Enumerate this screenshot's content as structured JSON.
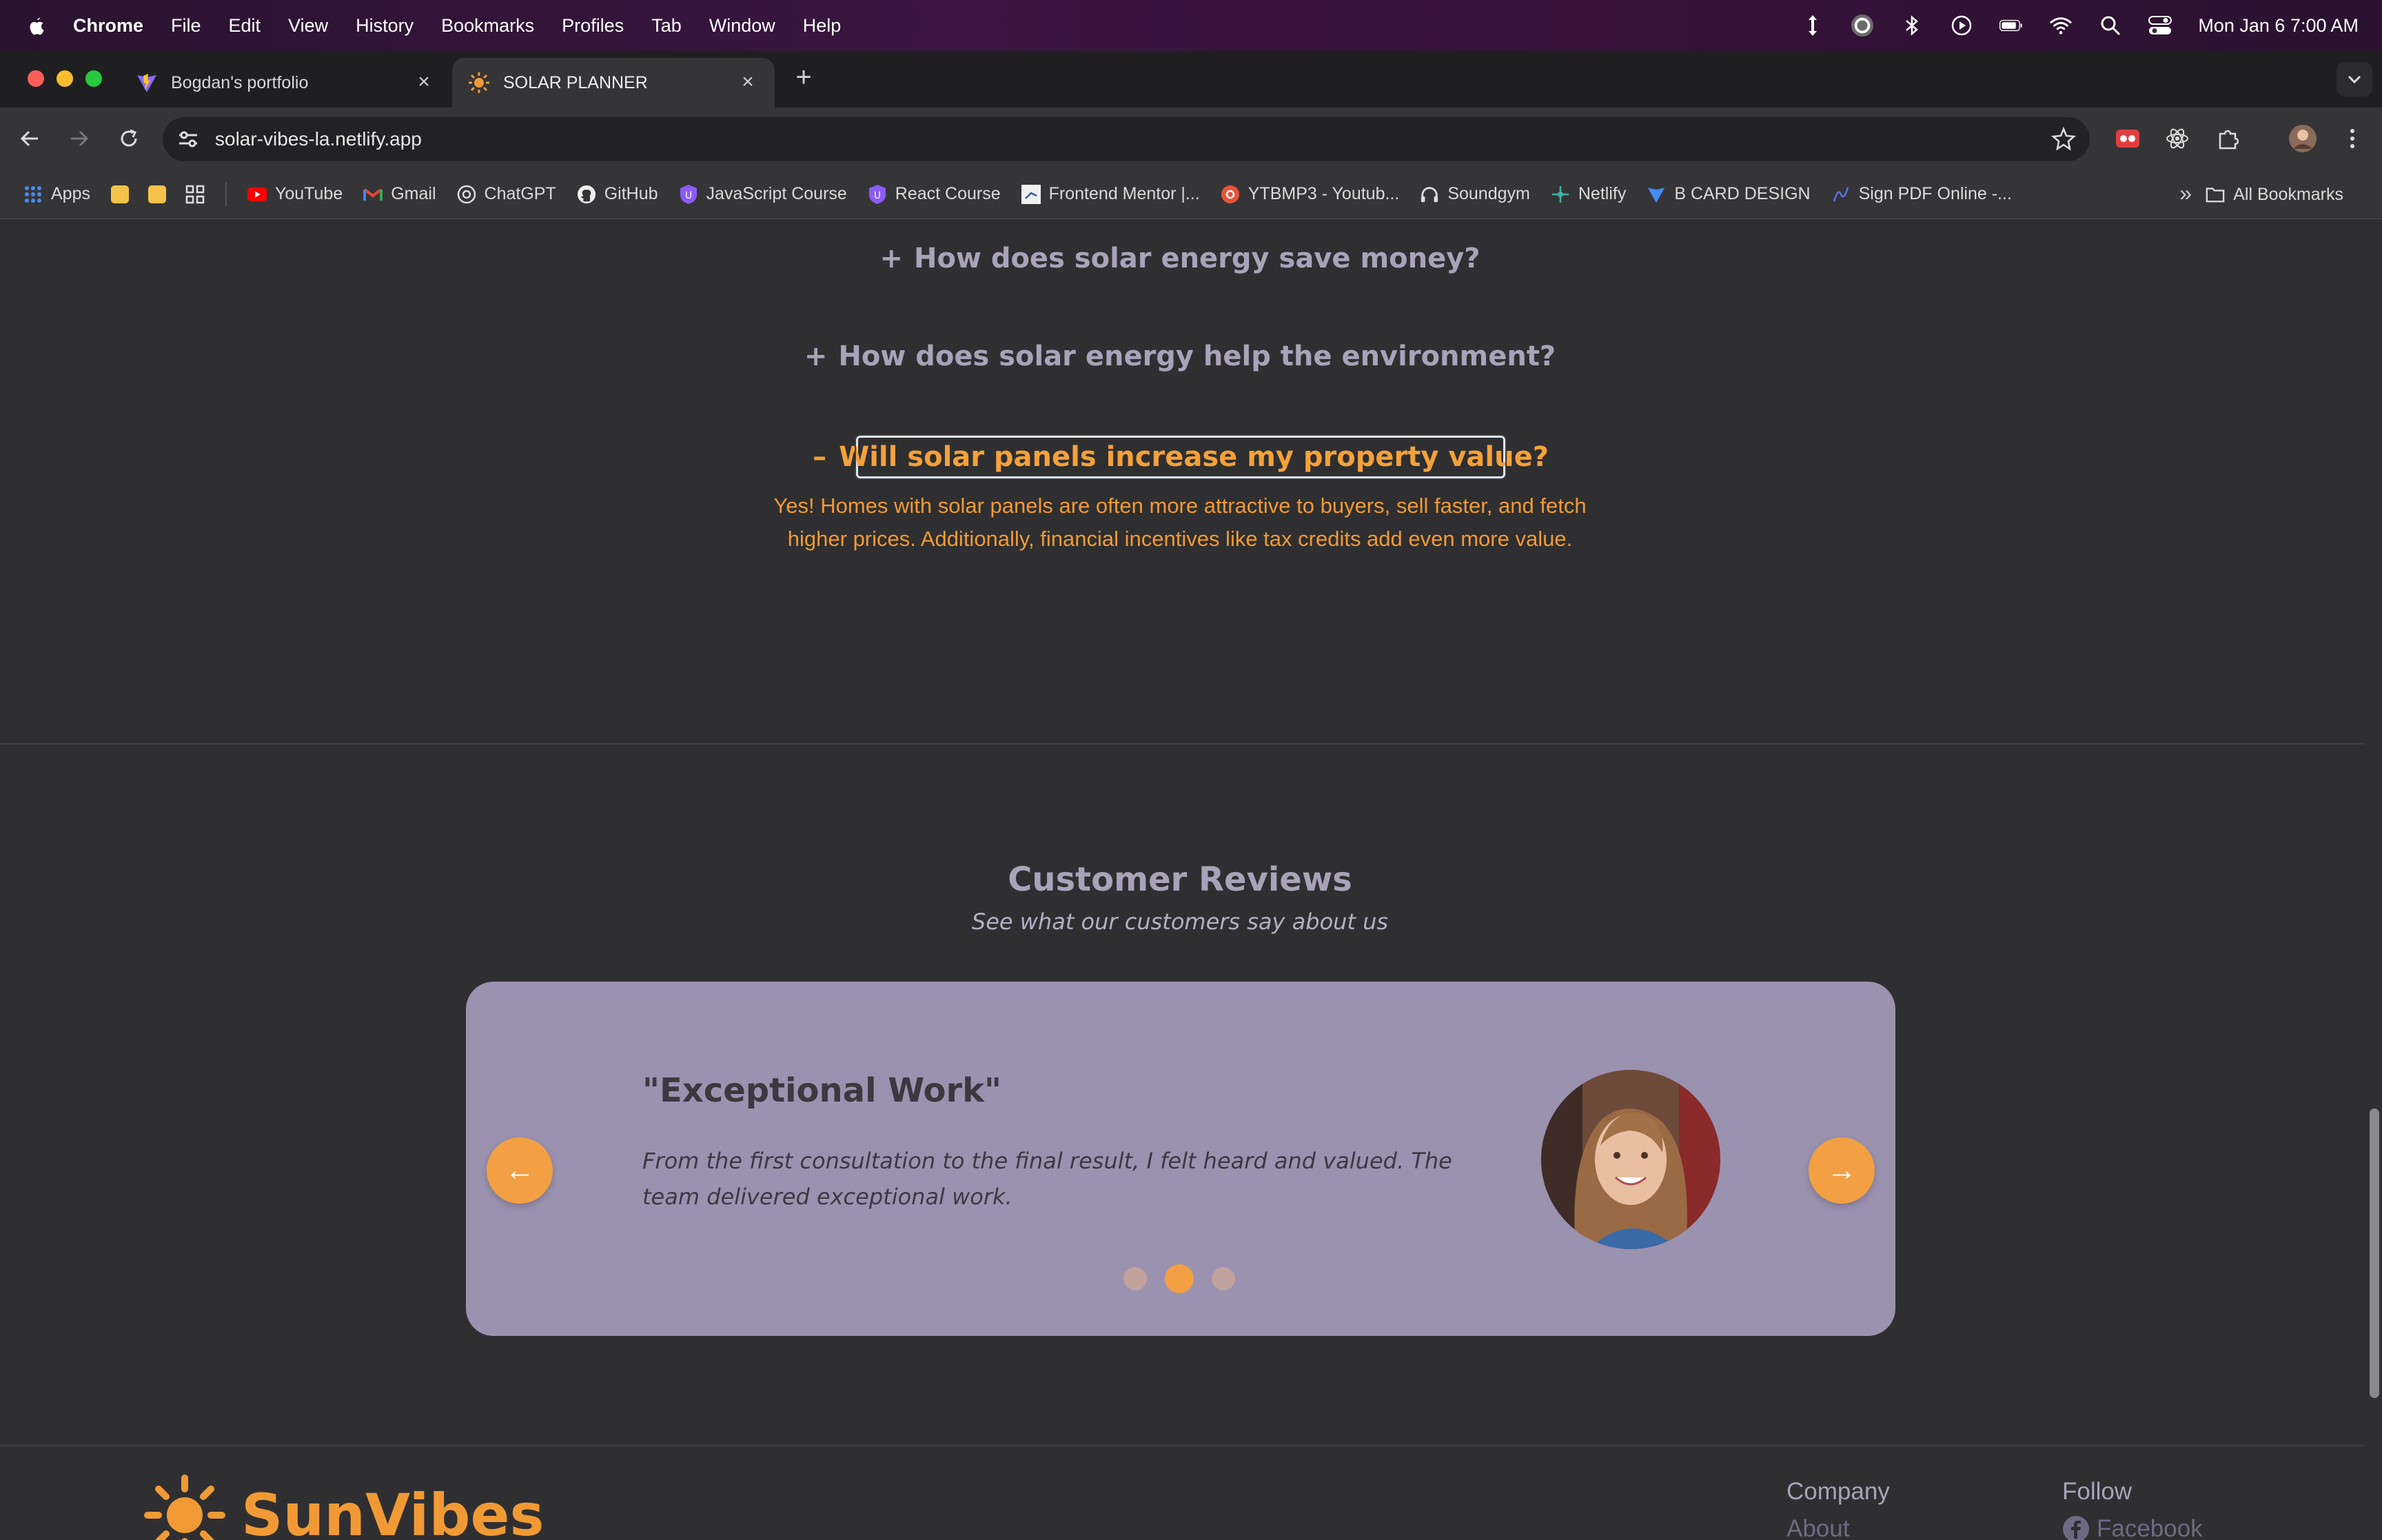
{
  "menubar": {
    "app": "Chrome",
    "items": [
      "File",
      "Edit",
      "View",
      "History",
      "Bookmarks",
      "Profiles",
      "Tab",
      "Window",
      "Help"
    ],
    "clock": "Mon Jan 6  7:00 AM"
  },
  "tabs": [
    {
      "title": "Bogdan's portfolio",
      "icon": "vite-icon"
    },
    {
      "title": "SOLAR PLANNER",
      "icon": "sun-icon"
    }
  ],
  "toolbar": {
    "url": "solar-vibes-la.netlify.app"
  },
  "bookmarks": {
    "apps": "Apps",
    "items": [
      "YouTube",
      "Gmail",
      "ChatGPT",
      "GitHub",
      "JavaScript Course",
      "React Course",
      "Frontend Mentor |...",
      "YTBMP3 - Youtub...",
      "Soundgym",
      "Netlify",
      "B CARD DESIGN",
      "Sign PDF Online -..."
    ],
    "all": "All Bookmarks"
  },
  "faq": {
    "q1": "How does solar energy save money?",
    "q2": "How does solar energy help the environment?",
    "q3": "Will solar panels increase my property value?",
    "plus": "+",
    "minus": "–",
    "answer": "Yes! Homes with solar panels are often more attractive to buyers, sell faster, and fetch higher prices. Additionally, financial incentives like tax credits add even more value."
  },
  "reviews": {
    "title": "Customer Reviews",
    "subtitle": "See what our customers say about us",
    "card_title": "\"Exceptional Work\"",
    "card_text": "From the first consultation to the final result, I felt heard and valued. The team delivered exceptional work.",
    "prev": "←",
    "next": "→",
    "active_slide": 2,
    "slide_count": 3
  },
  "footer": {
    "brand": "SunVibes",
    "company_heading": "Company",
    "company_link": "About",
    "follow_heading": "Follow",
    "follow_link": "Facebook"
  },
  "colors": {
    "accent": "#f19a35",
    "card_bg": "#9b92b0",
    "page_bg": "#2f2f31",
    "muted_heading": "#a8a3b9"
  }
}
